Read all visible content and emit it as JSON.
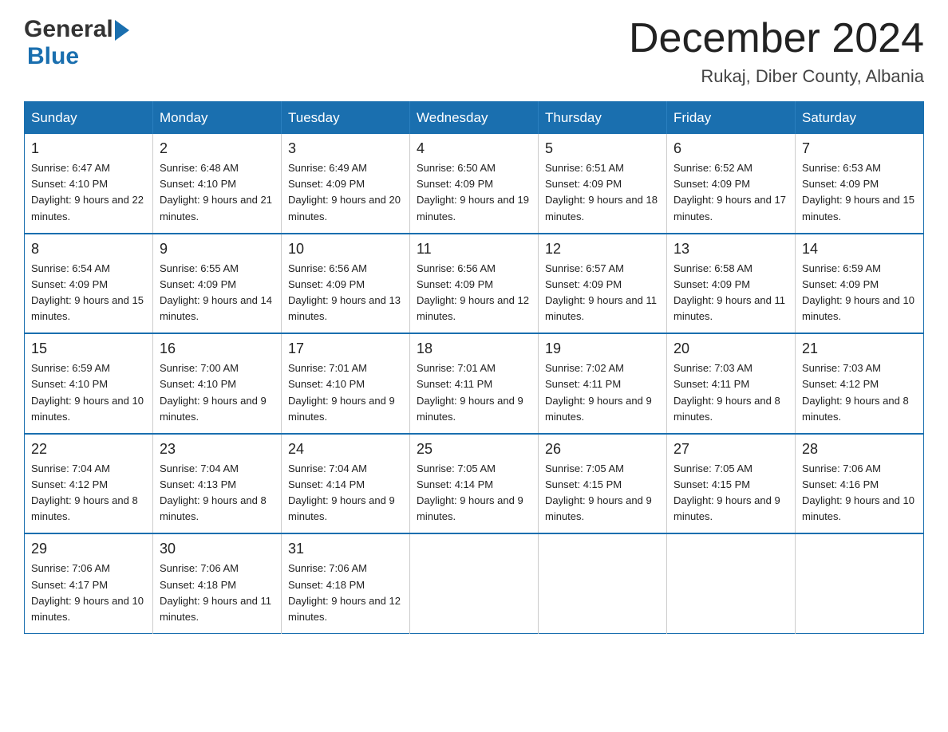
{
  "logo": {
    "general": "General",
    "blue": "Blue",
    "arrow_color": "#1a6faf"
  },
  "header": {
    "month_title": "December 2024",
    "location": "Rukaj, Diber County, Albania"
  },
  "days_of_week": [
    "Sunday",
    "Monday",
    "Tuesday",
    "Wednesday",
    "Thursday",
    "Friday",
    "Saturday"
  ],
  "weeks": [
    [
      {
        "day": "1",
        "sunrise": "Sunrise: 6:47 AM",
        "sunset": "Sunset: 4:10 PM",
        "daylight": "Daylight: 9 hours and 22 minutes."
      },
      {
        "day": "2",
        "sunrise": "Sunrise: 6:48 AM",
        "sunset": "Sunset: 4:10 PM",
        "daylight": "Daylight: 9 hours and 21 minutes."
      },
      {
        "day": "3",
        "sunrise": "Sunrise: 6:49 AM",
        "sunset": "Sunset: 4:09 PM",
        "daylight": "Daylight: 9 hours and 20 minutes."
      },
      {
        "day": "4",
        "sunrise": "Sunrise: 6:50 AM",
        "sunset": "Sunset: 4:09 PM",
        "daylight": "Daylight: 9 hours and 19 minutes."
      },
      {
        "day": "5",
        "sunrise": "Sunrise: 6:51 AM",
        "sunset": "Sunset: 4:09 PM",
        "daylight": "Daylight: 9 hours and 18 minutes."
      },
      {
        "day": "6",
        "sunrise": "Sunrise: 6:52 AM",
        "sunset": "Sunset: 4:09 PM",
        "daylight": "Daylight: 9 hours and 17 minutes."
      },
      {
        "day": "7",
        "sunrise": "Sunrise: 6:53 AM",
        "sunset": "Sunset: 4:09 PM",
        "daylight": "Daylight: 9 hours and 15 minutes."
      }
    ],
    [
      {
        "day": "8",
        "sunrise": "Sunrise: 6:54 AM",
        "sunset": "Sunset: 4:09 PM",
        "daylight": "Daylight: 9 hours and 15 minutes."
      },
      {
        "day": "9",
        "sunrise": "Sunrise: 6:55 AM",
        "sunset": "Sunset: 4:09 PM",
        "daylight": "Daylight: 9 hours and 14 minutes."
      },
      {
        "day": "10",
        "sunrise": "Sunrise: 6:56 AM",
        "sunset": "Sunset: 4:09 PM",
        "daylight": "Daylight: 9 hours and 13 minutes."
      },
      {
        "day": "11",
        "sunrise": "Sunrise: 6:56 AM",
        "sunset": "Sunset: 4:09 PM",
        "daylight": "Daylight: 9 hours and 12 minutes."
      },
      {
        "day": "12",
        "sunrise": "Sunrise: 6:57 AM",
        "sunset": "Sunset: 4:09 PM",
        "daylight": "Daylight: 9 hours and 11 minutes."
      },
      {
        "day": "13",
        "sunrise": "Sunrise: 6:58 AM",
        "sunset": "Sunset: 4:09 PM",
        "daylight": "Daylight: 9 hours and 11 minutes."
      },
      {
        "day": "14",
        "sunrise": "Sunrise: 6:59 AM",
        "sunset": "Sunset: 4:09 PM",
        "daylight": "Daylight: 9 hours and 10 minutes."
      }
    ],
    [
      {
        "day": "15",
        "sunrise": "Sunrise: 6:59 AM",
        "sunset": "Sunset: 4:10 PM",
        "daylight": "Daylight: 9 hours and 10 minutes."
      },
      {
        "day": "16",
        "sunrise": "Sunrise: 7:00 AM",
        "sunset": "Sunset: 4:10 PM",
        "daylight": "Daylight: 9 hours and 9 minutes."
      },
      {
        "day": "17",
        "sunrise": "Sunrise: 7:01 AM",
        "sunset": "Sunset: 4:10 PM",
        "daylight": "Daylight: 9 hours and 9 minutes."
      },
      {
        "day": "18",
        "sunrise": "Sunrise: 7:01 AM",
        "sunset": "Sunset: 4:11 PM",
        "daylight": "Daylight: 9 hours and 9 minutes."
      },
      {
        "day": "19",
        "sunrise": "Sunrise: 7:02 AM",
        "sunset": "Sunset: 4:11 PM",
        "daylight": "Daylight: 9 hours and 9 minutes."
      },
      {
        "day": "20",
        "sunrise": "Sunrise: 7:03 AM",
        "sunset": "Sunset: 4:11 PM",
        "daylight": "Daylight: 9 hours and 8 minutes."
      },
      {
        "day": "21",
        "sunrise": "Sunrise: 7:03 AM",
        "sunset": "Sunset: 4:12 PM",
        "daylight": "Daylight: 9 hours and 8 minutes."
      }
    ],
    [
      {
        "day": "22",
        "sunrise": "Sunrise: 7:04 AM",
        "sunset": "Sunset: 4:12 PM",
        "daylight": "Daylight: 9 hours and 8 minutes."
      },
      {
        "day": "23",
        "sunrise": "Sunrise: 7:04 AM",
        "sunset": "Sunset: 4:13 PM",
        "daylight": "Daylight: 9 hours and 8 minutes."
      },
      {
        "day": "24",
        "sunrise": "Sunrise: 7:04 AM",
        "sunset": "Sunset: 4:14 PM",
        "daylight": "Daylight: 9 hours and 9 minutes."
      },
      {
        "day": "25",
        "sunrise": "Sunrise: 7:05 AM",
        "sunset": "Sunset: 4:14 PM",
        "daylight": "Daylight: 9 hours and 9 minutes."
      },
      {
        "day": "26",
        "sunrise": "Sunrise: 7:05 AM",
        "sunset": "Sunset: 4:15 PM",
        "daylight": "Daylight: 9 hours and 9 minutes."
      },
      {
        "day": "27",
        "sunrise": "Sunrise: 7:05 AM",
        "sunset": "Sunset: 4:15 PM",
        "daylight": "Daylight: 9 hours and 9 minutes."
      },
      {
        "day": "28",
        "sunrise": "Sunrise: 7:06 AM",
        "sunset": "Sunset: 4:16 PM",
        "daylight": "Daylight: 9 hours and 10 minutes."
      }
    ],
    [
      {
        "day": "29",
        "sunrise": "Sunrise: 7:06 AM",
        "sunset": "Sunset: 4:17 PM",
        "daylight": "Daylight: 9 hours and 10 minutes."
      },
      {
        "day": "30",
        "sunrise": "Sunrise: 7:06 AM",
        "sunset": "Sunset: 4:18 PM",
        "daylight": "Daylight: 9 hours and 11 minutes."
      },
      {
        "day": "31",
        "sunrise": "Sunrise: 7:06 AM",
        "sunset": "Sunset: 4:18 PM",
        "daylight": "Daylight: 9 hours and 12 minutes."
      },
      null,
      null,
      null,
      null
    ]
  ]
}
